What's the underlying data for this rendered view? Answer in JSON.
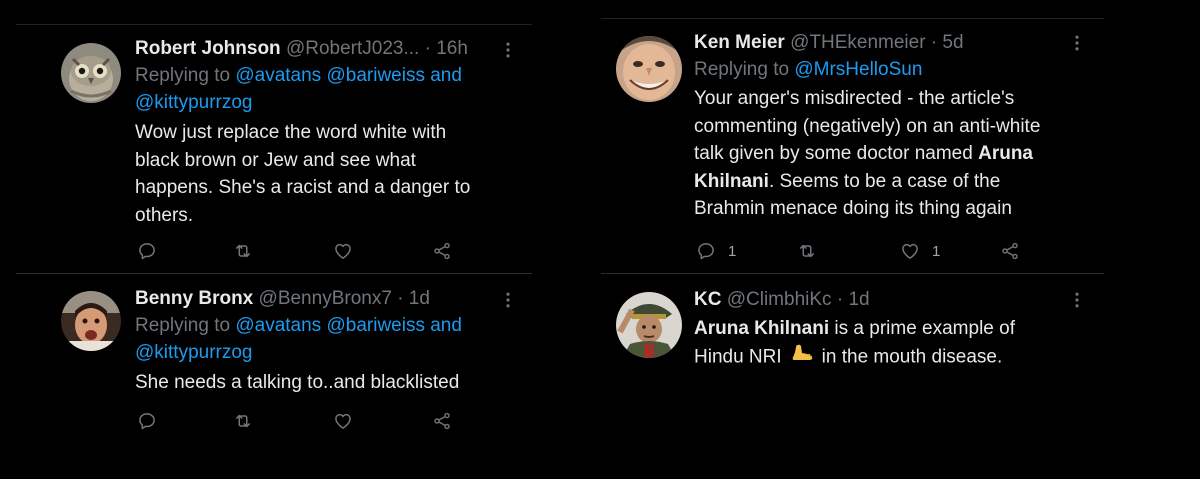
{
  "left_column": [
    {
      "name": "Robert Johnson",
      "handle": "@RobertJ023...",
      "time": "16h",
      "replying_prefix": "Replying to ",
      "mentions": [
        "@avatans",
        "@bariweiss",
        "@kittypurrzog"
      ],
      "conjunction": " and ",
      "text_lines": [
        "Wow just replace the word white with",
        "black brown or Jew and see what",
        "happens. She's a racist and a danger to",
        "others."
      ]
    },
    {
      "name": "Benny Bronx",
      "handle": "@BennyBronx7",
      "time": "1d",
      "replying_prefix": "Replying to ",
      "mentions": [
        "@avatans",
        "@bariweiss",
        "@kittypurrzog"
      ],
      "conjunction": " and ",
      "text_lines": [
        "She needs a talking to..and blacklisted"
      ]
    }
  ],
  "right_column": [
    {
      "name": "Ken Meier",
      "handle": "@THEkenmeier",
      "time": "5d",
      "replying_prefix": "Replying to ",
      "mention": "@MrsHelloSun",
      "text": {
        "line1": "Your anger's misdirected - the article's",
        "line2": "commenting (negatively) on an anti-white",
        "line3_plain": "talk given by some doctor named ",
        "line3_bold": "Aruna",
        "line4_bold": "Khilnani",
        "line4_plain": ". Seems to be a case of the",
        "line5": "Brahmin menace doing its thing again"
      },
      "reply_count": "1",
      "like_count": "1"
    },
    {
      "name": "KC",
      "handle": "@ClimbhiKc",
      "time": "1d",
      "text": {
        "line1_bold": "Aruna Khilnani",
        "line1_plain": " is a prime example of",
        "line2_before": "Hindu NRI",
        "line2_after": "in the mouth disease."
      },
      "emoji": "foot-emoji"
    }
  ],
  "separator": "·",
  "colors": {
    "background": "#000000",
    "text": "#e7e9ea",
    "secondary": "#71767b",
    "link": "#1d9bf0",
    "divider": "#2a2e33"
  },
  "icons": [
    "reply-icon",
    "retweet-icon",
    "like-icon",
    "share-icon",
    "more-icon"
  ]
}
